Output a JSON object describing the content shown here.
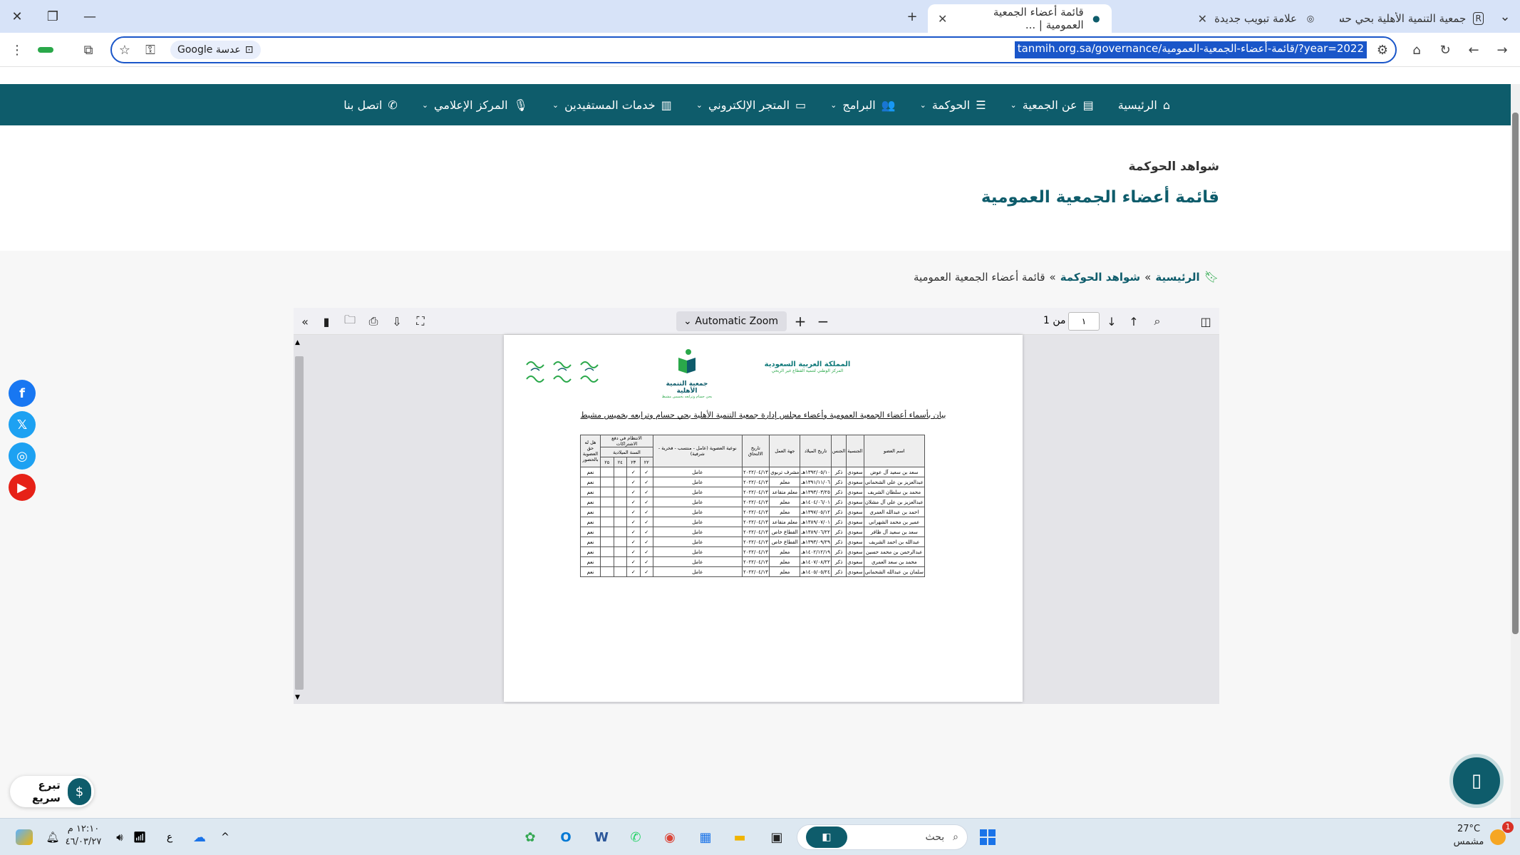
{
  "window": {
    "minimize": "—",
    "restore": "❐",
    "close": "✕"
  },
  "tabs": [
    {
      "title": "جمعية التنمية الأهلية بحي حسام و...",
      "icon": "R"
    },
    {
      "title": "علامة تبويب جديدة",
      "icon": "◎"
    },
    {
      "title": "قائمة أعضاء الجمعية العمومية | ...",
      "icon": "●"
    }
  ],
  "new_tab": "+",
  "tab_dropdown": "⌄",
  "addressbar": {
    "url": "tanmih.org.sa/governance/قائمة-أعضاء-الجمعية-العمومية/?year=2022",
    "lens_chip": "عدسة Google"
  },
  "nav": {
    "items": [
      {
        "label": "الرئيسية",
        "icon": "⌂",
        "has_menu": false
      },
      {
        "label": "عن الجمعية",
        "icon": "▤",
        "has_menu": true
      },
      {
        "label": "الحوكمة",
        "icon": "☰",
        "has_menu": true
      },
      {
        "label": "البرامج",
        "icon": "👥",
        "has_menu": true
      },
      {
        "label": "المتجر الإلكتروني",
        "icon": "▭",
        "has_menu": true
      },
      {
        "label": "خدمات المستفيدين",
        "icon": "▥",
        "has_menu": true
      },
      {
        "label": "المركز الإعلامي",
        "icon": "🎙",
        "has_menu": true
      },
      {
        "label": "اتصل بنا",
        "icon": "✆",
        "has_menu": false
      }
    ],
    "chevron": "⌄"
  },
  "page": {
    "kicker": "شواهد الحوكمة",
    "title": "قائمة أعضاء الجمعية العمومية"
  },
  "breadcrumb": {
    "home": "الرئيسية",
    "sep": "»",
    "section": "شواهد الحوكمة",
    "current": "قائمة أعضاء الجمعية العمومية"
  },
  "pdf": {
    "zoom": "Automatic Zoom",
    "page_current": "١",
    "page_of": "من 1",
    "doc": {
      "gov_line1": "المملكة العربية السعودية",
      "gov_line2": "المركز الوطني لتنمية القطاع غير الربحي",
      "assoc_name": "جمعية التنمية الأهلية",
      "assoc_sub": "بحي حسام وترابعه بخميس مشيط",
      "heading": "بيان بأسماء أعضاء الجمعية العمومية وأعضاء مجلس إدارة جمعية التنمية الأهلية بحي حسام وترابعه بخميس مشيط",
      "columns": [
        "اسم العضو",
        "الجنسية",
        "الجنس",
        "تاريخ الميلاد",
        "جهة العمل",
        "تاريخ الالتحاق",
        "نوعية العضوية (عامل - منتسب - فخرية - شرفية)",
        "الانتظام في دفع الاشتراكات",
        "هل له حق العضوية بالحضور"
      ],
      "subheader_group": "السنة الميلادية",
      "years": [
        "٢٢",
        "٢٣",
        "٢٤",
        "٢٥"
      ],
      "rows": [
        [
          "سعد بن سعيد آل عوض",
          "سعودي",
          "ذكر",
          "١٣٩٢/٠٥/١٠هـ",
          "مشرف تربوي",
          "٢٠٢٢/٠٤/١٣",
          "عامل",
          "✓",
          "✓",
          "",
          "",
          "نعم"
        ],
        [
          "عبدالعزيز بن علي الشحماني",
          "سعودي",
          "ذكر",
          "١٣٩١/١١/٠٦هـ",
          "معلم",
          "٢٠٢٢/٠٤/١٣",
          "عامل",
          "✓",
          "✓",
          "",
          "",
          "نعم"
        ],
        [
          "محمد بن سلطان الشريف",
          "سعودي",
          "ذكر",
          "١٣٩٣/٠٣/٢٥هـ",
          "معلم متقاعد",
          "٢٠٢٢/٠٤/١٣",
          "عامل",
          "✓",
          "✓",
          "",
          "",
          "نعم"
        ],
        [
          "عبدالعزيز بن علي آل مشلان",
          "سعودي",
          "ذكر",
          "١٤٠٤/٠٦/٠١هـ",
          "معلم",
          "٢٠٢٢/٠٤/١٣",
          "عامل",
          "✓",
          "✓",
          "",
          "",
          "نعم"
        ],
        [
          "احمد بن عبدالله العمري",
          "سعودي",
          "ذكر",
          "١٣٩٧/٠٥/١٢هـ",
          "معلم",
          "٢٠٢٢/٠٤/١٣",
          "عامل",
          "✓",
          "✓",
          "",
          "",
          "نعم"
        ],
        [
          "عمير بن محمد الشهراني",
          "سعودي",
          "ذكر",
          "١٣٨٩/٠٧/٠١هـ",
          "معلم متقاعد",
          "٢٠٢٢/٠٤/١٣",
          "عامل",
          "✓",
          "✓",
          "",
          "",
          "نعم"
        ],
        [
          "سعد بن سعيد آل ظافر",
          "سعودي",
          "ذكر",
          "١٣٨٩/٠٦/٢٢هـ",
          "القطاع خاص",
          "٢٠٢٢/٠٤/١٣",
          "عامل",
          "✓",
          "✓",
          "",
          "",
          "نعم"
        ],
        [
          "عبدالله بن احمد الشريف",
          "سعودي",
          "ذكر",
          "١٣٩٣/٠٩/٢٩هـ",
          "القطاع خاص",
          "٢٠٢٢/٠٤/١٣",
          "عامل",
          "✓",
          "✓",
          "",
          "",
          "نعم"
        ],
        [
          "عبدالرحمن بن محمد حسين",
          "سعودي",
          "ذكر",
          "١٤٠٢/١٢/١٩هـ",
          "معلم",
          "٢٠٢٢/٠٤/١٣",
          "عامل",
          "✓",
          "✓",
          "",
          "",
          "نعم"
        ],
        [
          "محمد بن سعد العمري",
          "سعودي",
          "ذكر",
          "١٤٠٧/٠٨/٢٢هـ",
          "معلم",
          "٢٠٢٢/٠٤/١٣",
          "عامل",
          "✓",
          "✓",
          "",
          "",
          "نعم"
        ],
        [
          "سلمان بن عبدالله الشحماني",
          "سعودي",
          "ذكر",
          "١٤٠٥/٠٥/٢٤هـ",
          "معلم",
          "٢٠٢٢/٠٤/١٣",
          "عامل",
          "✓",
          "✓",
          "",
          "",
          "نعم"
        ]
      ]
    }
  },
  "donate": {
    "label": "تبرع سريع"
  },
  "taskbar": {
    "search_placeholder": "بحث",
    "weather_temp": "27°C",
    "weather_desc": "مشمس",
    "clock_time": "١٢:١٠ م",
    "clock_date": "٤٦/٠٣/٢٧",
    "lang": "ع",
    "badge": "1"
  },
  "colors": {
    "brand": "#0e5c6b",
    "accent": "#2aa84a",
    "selection": "#1a56c9"
  }
}
